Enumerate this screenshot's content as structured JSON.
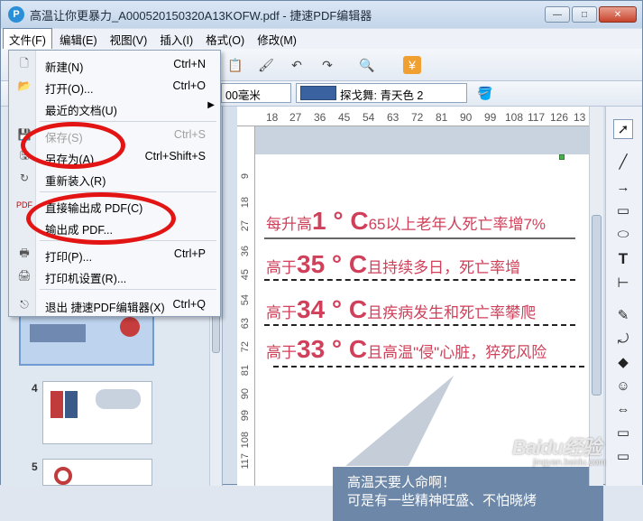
{
  "window": {
    "title": "高温让你更暴力_A000520150320A13KOFW.pdf - 捷速PDF编辑器",
    "app_icon": "P",
    "buttons": {
      "minimize": "—",
      "maximize": "□",
      "close": "✕"
    }
  },
  "menubar": {
    "items": [
      "文件(F)",
      "编辑(E)",
      "视图(V)",
      "插入(I)",
      "格式(O)",
      "修改(M)"
    ]
  },
  "toolbar": {
    "width_value": "00毫米",
    "fill_label": "探戈舞: 青天色 2"
  },
  "file_menu": {
    "items": [
      {
        "label": "新建(N)",
        "shortcut": "Ctrl+N",
        "icon": "new-file-icon",
        "disabled": false
      },
      {
        "label": "打开(O)...",
        "shortcut": "Ctrl+O",
        "icon": "open-folder-icon",
        "disabled": false
      },
      {
        "label": "最近的文档(U)",
        "shortcut": "",
        "icon": "",
        "disabled": false,
        "submenu": true
      },
      {
        "label": "保存(S)",
        "shortcut": "Ctrl+S",
        "icon": "save-icon",
        "disabled": true
      },
      {
        "label": "另存为(A)...",
        "shortcut": "Ctrl+Shift+S",
        "icon": "save-as-icon",
        "disabled": false
      },
      {
        "label": "重新装入(R)",
        "shortcut": "",
        "icon": "reload-icon",
        "disabled": false
      },
      {
        "label": "直接输出成 PDF(C)",
        "shortcut": "",
        "icon": "pdf-export-icon",
        "disabled": false
      },
      {
        "label": "输出成 PDF...",
        "shortcut": "",
        "icon": "",
        "disabled": false
      },
      {
        "label": "打印(P)...",
        "shortcut": "Ctrl+P",
        "icon": "print-icon",
        "disabled": false
      },
      {
        "label": "打印机设置(R)...",
        "shortcut": "",
        "icon": "printer-settings-icon",
        "disabled": false
      },
      {
        "label": "退出 捷速PDF编辑器(X)",
        "shortcut": "Ctrl+Q",
        "icon": "exit-icon",
        "disabled": false
      }
    ]
  },
  "ruler": {
    "top": [
      "18",
      "27",
      "36",
      "45",
      "54",
      "63",
      "72",
      "81",
      "90",
      "99",
      "108",
      "117",
      "126",
      "13"
    ],
    "left": [
      "9",
      "18",
      "27",
      "36",
      "45",
      "54",
      "63",
      "72",
      "81",
      "90",
      "99",
      "108",
      "117",
      "126"
    ]
  },
  "document": {
    "lines": [
      {
        "prefix": "每升高",
        "big": "1 ° C",
        "suffix": "65以上老年人死亡率增7%"
      },
      {
        "prefix": "高于",
        "big": "35 ° C",
        "suffix": "且持续多日，死亡率增"
      },
      {
        "prefix": "高于",
        "big": "34 ° C",
        "suffix": "且疾病发生和死亡率攀爬"
      },
      {
        "prefix": "高于",
        "big": "33 ° C",
        "suffix": "且高温\"侵\"心脏，猝死风险"
      }
    ],
    "callout": [
      "高温天要人命啊！",
      "可是有一些精神旺盛、不怕晓烤"
    ]
  },
  "thumbnails": [
    "4",
    "5"
  ],
  "watermark": {
    "text": "Baidu经验",
    "sub": "jingyan.baidu.com"
  }
}
